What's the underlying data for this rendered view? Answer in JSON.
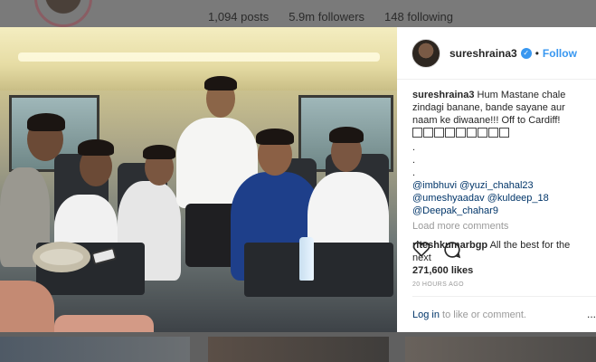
{
  "background_profile": {
    "posts": "1,094 posts",
    "followers": "5.9m followers",
    "following": "148 following"
  },
  "post": {
    "username": "sureshraina3",
    "follow_label": "Follow",
    "dot": "•",
    "caption_user": "sureshraina3",
    "caption_text": "Hum Mastane chale zindagi banane, bande sayane aur naam ke diwaane!!! Off to Cardiff!",
    "emoji_icons": [
      "flag-icon",
      "flag-icon",
      "flag-icon",
      "flag-icon",
      "flag-icon",
      "flag-icon",
      "flag-icon",
      "flag-icon",
      "flag-icon"
    ],
    "dots": [
      ".",
      ".",
      "."
    ],
    "mentions": [
      "@imbhuvi",
      "@yuzi_chahal23",
      "@umeshyaadav",
      "@kuldeep_18",
      "@Deepak_chahar9"
    ],
    "load_more": "Load more comments",
    "comment2_user": "riteshkumarbgp",
    "comment2_text": "All the best for the next",
    "likes": "271,600 likes",
    "time": "20 HOURS AGO",
    "login_link": "Log in",
    "login_rest": "to like or comment.",
    "more": "..."
  },
  "colors": {
    "accent": "#3897f0",
    "link": "#003569",
    "muted": "#999999",
    "text": "#262626"
  }
}
